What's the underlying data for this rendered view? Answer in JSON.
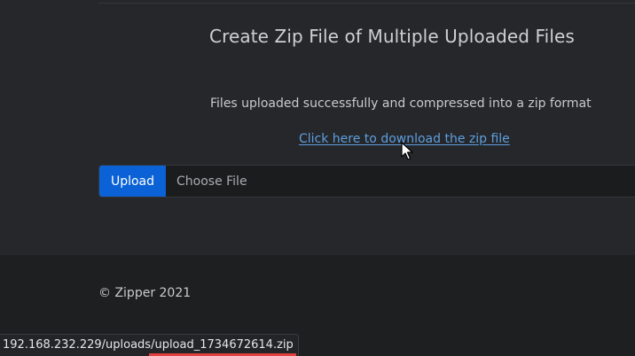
{
  "main": {
    "title": "Create Zip File of Multiple Uploaded Files",
    "success_message": "Files uploaded successfully and compressed into a zip format",
    "download_link": "Click here to download the zip file"
  },
  "upload_form": {
    "upload_label": "Upload",
    "file_placeholder": "Choose File"
  },
  "footer": {
    "copyright": "© Zipper 2021"
  },
  "status_bar": {
    "url": "192.168.232.229/uploads/upload_1734672614.zip"
  },
  "colors": {
    "accent": "#0b62d6",
    "link": "#5e9fe0",
    "background": "#25272a",
    "footer_background": "#1e1f21"
  },
  "icons": {
    "cursor": "arrow-cursor-icon"
  }
}
